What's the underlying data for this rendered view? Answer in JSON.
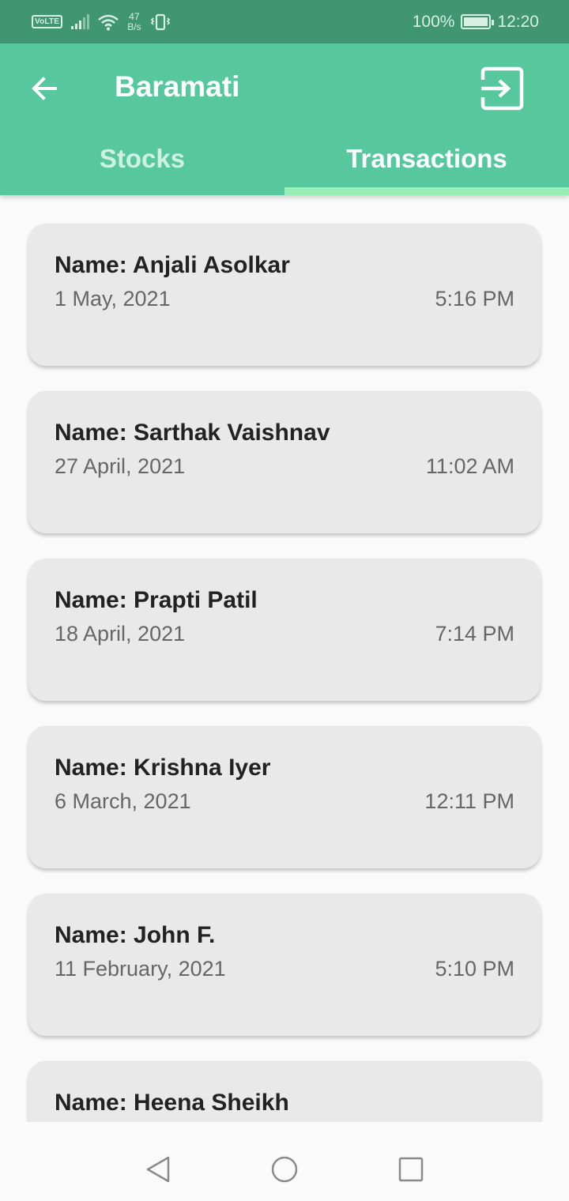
{
  "status_bar": {
    "volte": "VoLTE",
    "speed_value": "47",
    "speed_unit": "B/s",
    "battery": "100%",
    "time": "12:20",
    "icons": [
      "signal-icon",
      "wifi-icon",
      "vibrate-icon",
      "battery-icon"
    ]
  },
  "header": {
    "title": "Baramati",
    "back_icon": "back-arrow-icon",
    "exit_icon": "exit-icon"
  },
  "tabs": [
    {
      "label": "Stocks",
      "active": false
    },
    {
      "label": "Transactions",
      "active": true
    }
  ],
  "transactions": [
    {
      "name": "Name: Anjali Asolkar",
      "date": "1 May, 2021",
      "time": "5:16 PM"
    },
    {
      "name": "Name: Sarthak Vaishnav",
      "date": "27 April, 2021",
      "time": "11:02 AM"
    },
    {
      "name": "Name: Prapti Patil",
      "date": "18 April, 2021",
      "time": "7:14 PM"
    },
    {
      "name": "Name: Krishna Iyer",
      "date": "6 March, 2021",
      "time": "12:11 PM"
    },
    {
      "name": "Name: John F.",
      "date": "11 February, 2021",
      "time": "5:10 PM"
    },
    {
      "name": "Name: Heena Sheikh",
      "date": "",
      "time": ""
    }
  ],
  "nav_bar": {
    "back": "nav-back-icon",
    "home": "nav-home-icon",
    "recents": "nav-recents-icon"
  },
  "colors": {
    "status_bar": "#409573",
    "app_bar": "#57c89e",
    "tab_indicator": "#98efb3",
    "card": "#e9e9e9"
  }
}
